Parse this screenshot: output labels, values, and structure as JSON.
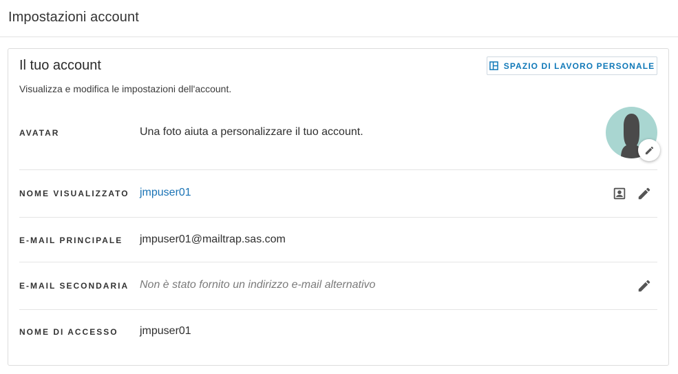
{
  "page": {
    "title": "Impostazioni account"
  },
  "card": {
    "title": "Il tuo account",
    "subtitle": "Visualizza e modifica le impostazioni dell'account.",
    "workspace_button": {
      "label": "SPAZIO DI LAVORO PERSONALE",
      "icon": "workspace-icon"
    }
  },
  "rows": {
    "avatar": {
      "label": "AVATAR",
      "value": "Una foto aiuta a personalizzare il tuo account.",
      "edit_icon": "pencil-icon"
    },
    "display_name": {
      "label": "NOME VISUALIZZATO",
      "value": "jmpuser01",
      "contact_icon": "contact-card-icon",
      "edit_icon": "pencil-icon"
    },
    "primary_email": {
      "label": "E-MAIL PRINCIPALE",
      "value": "jmpuser01@mailtrap.sas.com"
    },
    "secondary_email": {
      "label": "E-MAIL SECONDARIA",
      "value": "Non è stato fornito un indirizzo e-mail alternativo",
      "edit_icon": "pencil-icon"
    },
    "login_name": {
      "label": "NOME DI ACCESSO",
      "value": "jmpuser01"
    }
  },
  "colors": {
    "accent": "#1a73b5",
    "avatar_bg": "#a9d6d1",
    "avatar_silhouette": "#4a4a4a",
    "divider": "#e4e4e4"
  }
}
